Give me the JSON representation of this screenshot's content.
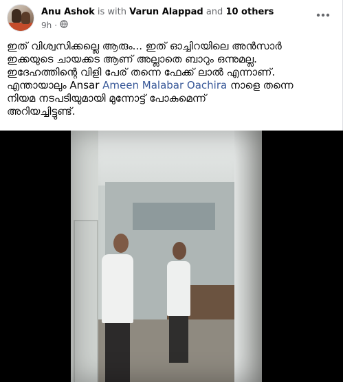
{
  "post": {
    "author": "Anu Ashok",
    "with_text": "is with",
    "tagged_person": "Varun Alappad",
    "and_text": "and",
    "others": "10 others",
    "timestamp": "9h",
    "privacy_icon": "globe-icon",
    "more_icon": "more-options-icon",
    "body_lines": [
      "ഇത് വിശ്വസിക്കല്ലെ ആരും... ഇത് ഓച്ചിറയിലെ അൻസാർ",
      "ഇക്കയുടെ ചായക്കട ആണ് അല്ലാതെ ബാറും ഒന്നുമല്ല.",
      "ഇദേഹത്തിന്റെ വിളി പേര് തന്നെ ഫേക്ക് ലാൽ എന്നാണ്.",
      "എന്തായാലും Ansar",
      "Ameen Malabar Oachira",
      "നാളെ തന്നെ",
      "നിയമ നടപടിയുമായി മുന്നോട്ട് പോകുമെന്ന്",
      "അറിയച്ചിട്ടുണ്ട്."
    ]
  },
  "colors": {
    "link": "#385898",
    "muted": "#65676b",
    "text": "#050505"
  }
}
